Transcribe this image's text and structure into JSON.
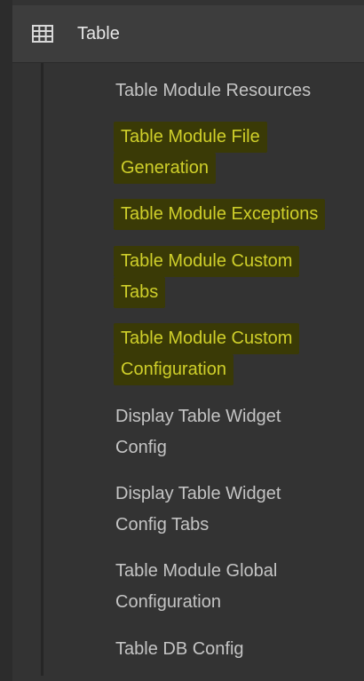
{
  "section": {
    "title": "Table",
    "icon": "table-grid-icon"
  },
  "menu": {
    "items": [
      {
        "lines": [
          "Table Module Resources"
        ],
        "highlighted": false
      },
      {
        "lines": [
          "Table Module File",
          "Generation"
        ],
        "highlighted": true
      },
      {
        "lines": [
          "Table Module Exceptions"
        ],
        "highlighted": true
      },
      {
        "lines": [
          "Table Module Custom",
          "Tabs"
        ],
        "highlighted": true
      },
      {
        "lines": [
          "Table Module Custom",
          "Configuration"
        ],
        "highlighted": true
      },
      {
        "lines": [
          "Display Table Widget",
          "Config"
        ],
        "highlighted": false
      },
      {
        "lines": [
          "Display Table Widget",
          "Config Tabs"
        ],
        "highlighted": false
      },
      {
        "lines": [
          "Table Module Global",
          "Configuration"
        ],
        "highlighted": false
      },
      {
        "lines": [
          "Table DB Config"
        ],
        "highlighted": false
      }
    ]
  },
  "colors": {
    "background": "#333333",
    "text": "#c4c4c4",
    "highlight_text": "#cfcf2a",
    "highlight_bg": "#3a3a06"
  }
}
